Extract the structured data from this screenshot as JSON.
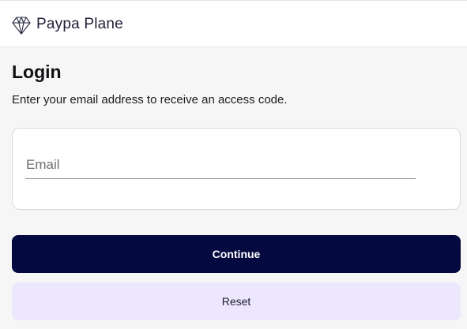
{
  "header": {
    "logo_icon": "diamond-logo-icon",
    "brand_name": "Paypa Plane"
  },
  "login": {
    "title": "Login",
    "subtitle": "Enter your email address to receive an access code.",
    "email": {
      "placeholder": "Email",
      "value": ""
    },
    "continue_label": "Continue",
    "reset_label": "Reset"
  },
  "colors": {
    "primary_button": "#040a40",
    "secondary_button": "#ede7fd",
    "page_background": "#f6f6f6"
  }
}
